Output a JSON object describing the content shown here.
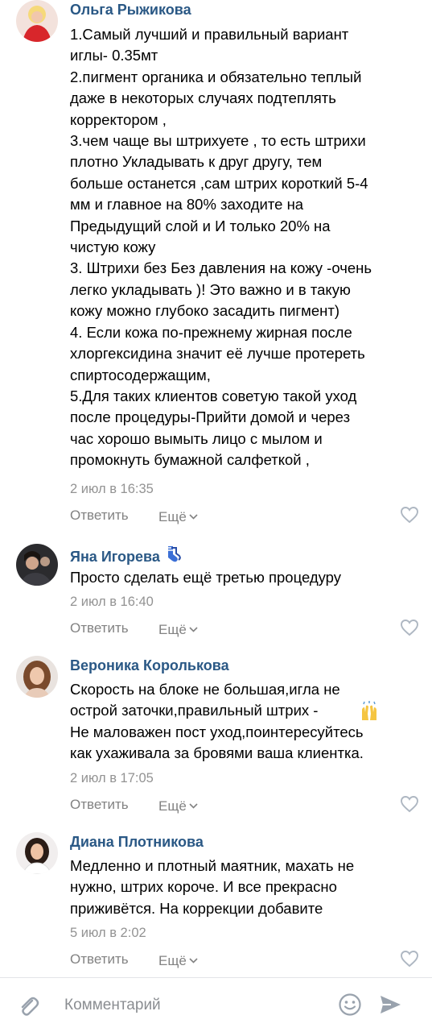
{
  "comments": [
    {
      "author": "Ольга Рыжикова",
      "text": "1.Самый лучший и правильный вариант\nиглы- 0.35мт\n2.пигмент органика и обязательно теплый\nдаже в некоторых случаях подтеплять\nкорректором ,\n3.чем чаще вы штрихуете , то есть штрихи\nплотно Укладывать к друг другу, тем\nбольше останется ,сам штрих короткий 5-4\nмм и главное на 80% заходите на\nПредыдущий слой и И только 20% на\nчистую кожу\n3. Штрихи без Без давления на кожу -очень\nлегко укладывать )! Это важно и в такую\nкожу можно глубоко засадить пигмент)\n4. Если кожа по-прежнему жирная после\nхлоргексидина значит её лучше протереть\nспиртосодержащим,\n5.Для таких клиентов советую такой уход\nпосле процедуры-Прийти домой и через\nчас хорошо вымыть лицо с мылом и\nпромокнуть бумажной салфеткой ,",
      "time": "2 июл в 16:35",
      "reply_label": "Ответить",
      "more_label": "Ещё",
      "name_emoji": "",
      "avatar_icon": "avatar-woman-red-dress"
    },
    {
      "author": "Яна Игорева",
      "text": "Просто сделать ещё третью процедуру",
      "time": "2 июл в 16:40",
      "reply_label": "Ответить",
      "more_label": "Ещё",
      "name_emoji": "socks-emoji",
      "avatar_icon": "avatar-dark-photo"
    },
    {
      "author": "Вероника Королькова",
      "text": "Скорость на блоке не большая,игла не\nострой заточки,правильный штрих -\nНе маловажен пост уход,поинтересуйтесь\nкак ухаживала за бровями ваша клиентка.",
      "text_emoji": "raising-hands-emoji",
      "time": "2 июл в 17:05",
      "reply_label": "Ответить",
      "more_label": "Ещё",
      "avatar_icon": "avatar-woman-curly-hair"
    },
    {
      "author": "Диана Плотникова",
      "text": "Медленно и плотный маятник, махать не\nнужно, штрих короче. И все прекрасно\nприживётся. На коррекции добавите",
      "time": "5 июл в 2:02",
      "reply_label": "Ответить",
      "more_label": "Ещё",
      "avatar_icon": "avatar-woman-dark-hair"
    }
  ],
  "composer": {
    "placeholder": "Комментарий",
    "attach_icon": "paperclip-icon",
    "emoji_icon": "smile-icon",
    "send_icon": "send-icon"
  },
  "colors": {
    "author": "#2a5885",
    "meta": "#939393",
    "action": "#828282",
    "divider": "#e3e4e8"
  }
}
